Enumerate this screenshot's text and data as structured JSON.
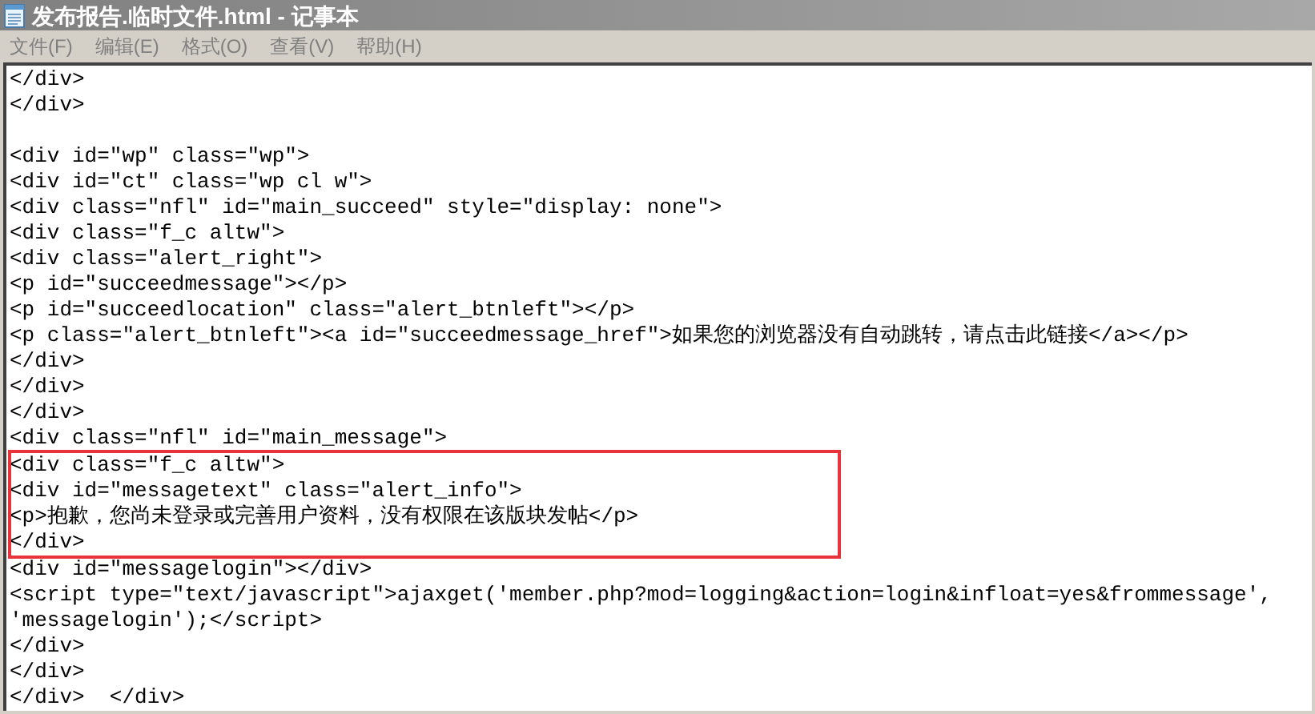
{
  "window": {
    "title": "发布报告.临时文件.html - 记事本"
  },
  "menu": [
    {
      "label": "文件(F)"
    },
    {
      "label": "编辑(E)"
    },
    {
      "label": "格式(O)"
    },
    {
      "label": "查看(V)"
    },
    {
      "label": "帮助(H)"
    }
  ],
  "blocks": [
    {
      "kind": "plain",
      "lines": [
        "</div>",
        "</div>"
      ]
    },
    {
      "kind": "blank"
    },
    {
      "kind": "plain",
      "lines": [
        "<div id=\"wp\" class=\"wp\">",
        "<div id=\"ct\" class=\"wp cl w\">",
        "<div class=\"nfl\" id=\"main_succeed\" style=\"display: none\">",
        "<div class=\"f_c altw\">",
        "<div class=\"alert_right\">",
        "<p id=\"succeedmessage\"></p>",
        "<p id=\"succeedlocation\" class=\"alert_btnleft\"></p>",
        "<p class=\"alert_btnleft\"><a id=\"succeedmessage_href\">如果您的浏览器没有自动跳转，请点击此链接</a></p>",
        "</div>",
        "</div>",
        "</div>",
        "<div class=\"nfl\" id=\"main_message\">"
      ]
    },
    {
      "kind": "highlighted",
      "lines": [
        "<div class=\"f_c altw\">",
        "<div id=\"messagetext\" class=\"alert_info\">",
        "<p>抱歉，您尚未登录或完善用户资料，没有权限在该版块发帖</p>",
        "</div>"
      ]
    },
    {
      "kind": "plain",
      "lines": [
        "<div id=\"messagelogin\"></div>",
        "<script type=\"text/javascript\">ajaxget('member.php?mod=logging&action=login&infloat=yes&frommessage',",
        "'messagelogin');</script>",
        "</div>",
        "</div>",
        "</div>  </div>"
      ]
    }
  ]
}
